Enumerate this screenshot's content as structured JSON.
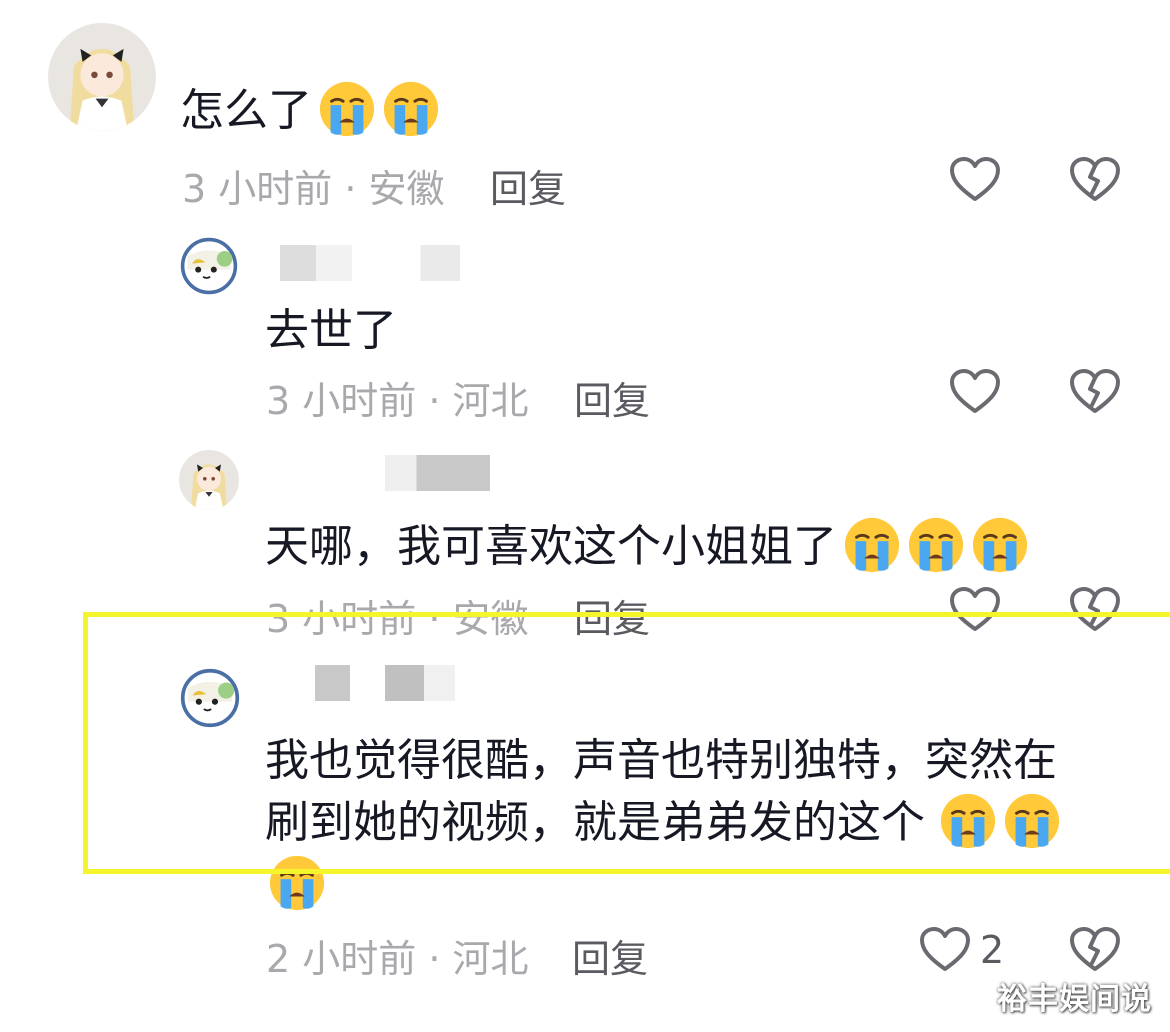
{
  "comments": [
    {
      "text": "怎么了",
      "meta": "3 小时前 · 安徽",
      "reply": "回复"
    },
    {
      "text": "去世了",
      "meta": "3 小时前 · 河北",
      "reply": "回复"
    },
    {
      "text": "天哪，我可喜欢这个小姐姐了",
      "meta": "3 小时前 · 安徽",
      "reply": "回复"
    },
    {
      "text_line1": "我也觉得很酷，声音也特别独特，突然在",
      "text_line2": "刷到她的视频，就是弟弟发的这个",
      "meta": "2 小时前 · 河北",
      "reply": "回复",
      "like_count": "2"
    }
  ],
  "icons": {
    "like": "heart-outline-icon",
    "dislike": "broken-heart-icon",
    "emoji": "loudly-crying-face"
  },
  "colors": {
    "highlight": "#f5f52c",
    "text": "#161823",
    "meta": "#a9a9ad"
  },
  "watermark": "裕丰娱间说"
}
